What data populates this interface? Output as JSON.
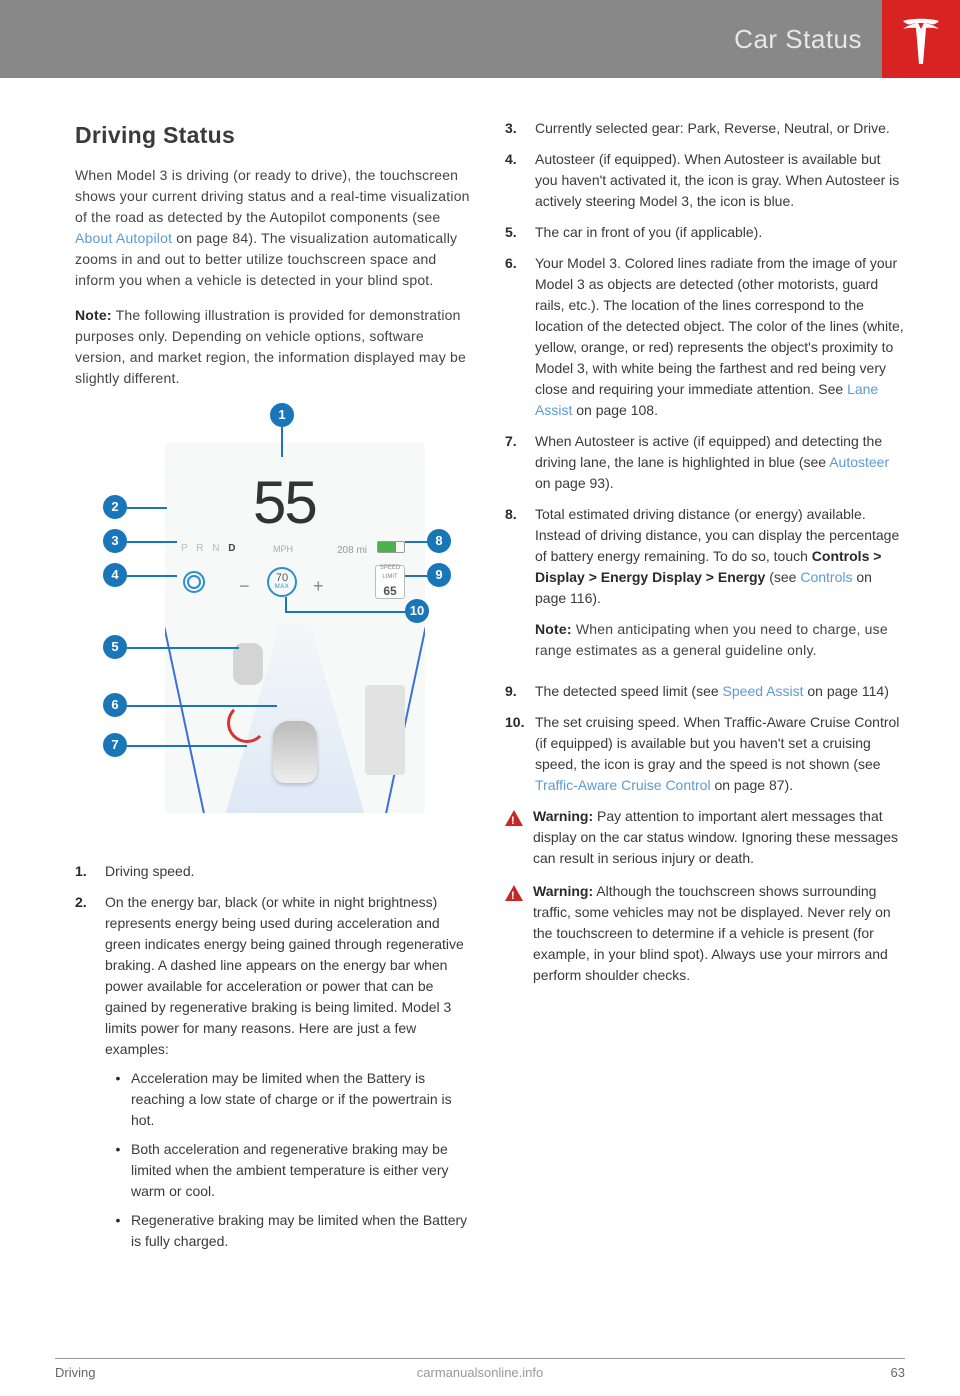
{
  "header": {
    "title": "Car Status"
  },
  "section_heading": "Driving Status",
  "intro_part1": "When Model 3 is driving (or ready to drive), the touchscreen shows your current driving status and a real-time visualization of the road as detected by the Autopilot components (see ",
  "intro_link": "About Autopilot",
  "intro_part2": " on page 84). The visualization automatically zooms in and out to better utilize touchscreen space and inform you when a vehicle is detected in your blind spot.",
  "note_label": "Note:",
  "note_text": " The following illustration is provided for demonstration purposes only. Depending on vehicle options, software version, and market region, the information displayed may be slightly different.",
  "illustration": {
    "speed": "55",
    "gears": "P R N ",
    "gear_selected": "D",
    "unit": "MPH",
    "range": "208 mi",
    "cruise_value": "70",
    "cruise_max": "MAX",
    "limit_top": "SPEED",
    "limit_mid": "LIMIT",
    "limit_value": "65",
    "callouts": [
      "1",
      "2",
      "3",
      "4",
      "5",
      "6",
      "7",
      "8",
      "9",
      "10"
    ]
  },
  "list_left": [
    {
      "n": "1.",
      "body": "Driving speed."
    },
    {
      "n": "2.",
      "body": "On the energy bar, black (or white in night brightness) represents energy being used during acceleration and green indicates energy being gained through regenerative braking. A dashed line appears on the energy bar when power available for acceleration or power that can be gained by regenerative braking is being limited. Model 3 limits power for many reasons. Here are just a few examples:",
      "sub": [
        "Acceleration may be limited when the Battery is reaching a low state of charge or if the powertrain is hot.",
        "Both acceleration and regenerative braking may be limited when the ambient temperature is either very warm or cool.",
        "Regenerative braking may be limited when the Battery is fully charged."
      ]
    }
  ],
  "list_right": [
    {
      "n": "3.",
      "body": "Currently selected gear: Park, Reverse, Neutral, or Drive."
    },
    {
      "n": "4.",
      "body": "Autosteer (if equipped). When Autosteer is available but you haven't activated it, the icon is gray. When Autosteer is actively steering Model 3, the icon is blue."
    },
    {
      "n": "5.",
      "body": "The car in front of you (if applicable)."
    },
    {
      "n": "6.",
      "body_pre": "Your Model 3. Colored lines radiate from the image of your Model 3 as objects are detected (other motorists, guard rails, etc.). The location of the lines correspond to the location of the detected object. The color of the lines (white, yellow, orange, or red) represents the object's proximity to Model 3, with white being the farthest and red being very close and requiring your immediate attention. See ",
      "link": "Lane Assist",
      "body_post": " on page 108."
    },
    {
      "n": "7.",
      "body_pre": "When Autosteer is active (if equipped) and detecting the driving lane, the lane is highlighted in blue (see ",
      "link": "Autosteer",
      "body_post": " on page 93)."
    },
    {
      "n": "8.",
      "body_pre": "Total estimated driving distance (or energy) available. Instead of driving distance, you can display the percentage of battery energy remaining. To do so, touch ",
      "bold_path": "Controls > Display > Energy Display > Energy",
      "body_mid": " (see ",
      "link": "Controls",
      "body_post": " on page 116).",
      "note": " When anticipating when you need to charge, use range estimates as a general guideline only."
    },
    {
      "n": "9.",
      "body_pre": "The detected speed limit (see ",
      "link": "Speed Assist",
      "body_post": " on page 114)"
    },
    {
      "n": "10.",
      "body_pre": "The set cruising speed. When Traffic-Aware Cruise Control (if equipped) is available but you haven't set a cruising speed, the icon is gray and the speed is not shown (see ",
      "link": "Traffic-Aware Cruise Control",
      "body_post": " on page 87)."
    }
  ],
  "warning_label": "Warning:",
  "warnings": [
    " Pay attention to important alert messages that display on the car status window. Ignoring these messages can result in serious injury or death.",
    " Although the touchscreen shows surrounding traffic, some vehicles may not be displayed. Never rely on the touchscreen to determine if a vehicle is present (for example, in your blind spot). Always use your mirrors and perform shoulder checks."
  ],
  "footer": {
    "left": "Driving",
    "right": "63",
    "watermark": "carmanualsonline.info"
  }
}
